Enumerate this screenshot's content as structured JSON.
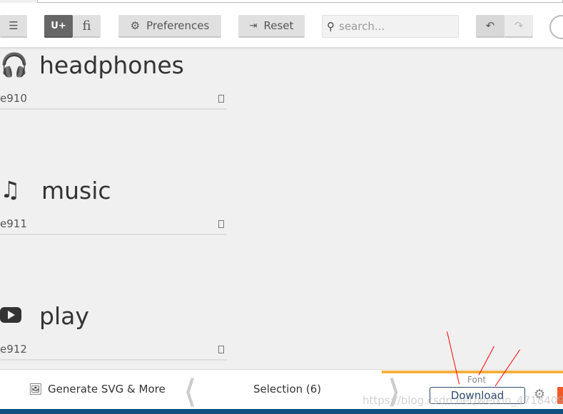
{
  "toolbar": {
    "unicode_label": "U+",
    "ligature_label": "fi",
    "preferences_label": "Preferences",
    "reset_label": "Reset",
    "search_placeholder": "search..."
  },
  "glyphs": [
    {
      "name": "headphones",
      "code": "e910",
      "icon": "headphones-icon"
    },
    {
      "name": "music",
      "code": "e911",
      "icon": "music-icon"
    },
    {
      "name": "play",
      "code": "e912",
      "icon": "play-icon"
    }
  ],
  "bottom": {
    "generate_label": "Generate SVG & More",
    "selection_label": "Selection (6)",
    "font_label": "Font",
    "download_label": "Download"
  },
  "watermark": "https://blog.csdn.net/weixin_47184093",
  "colors": {
    "accent": "#f5b041",
    "footer": "#0b5181",
    "download_border": "#2c4a6b"
  }
}
